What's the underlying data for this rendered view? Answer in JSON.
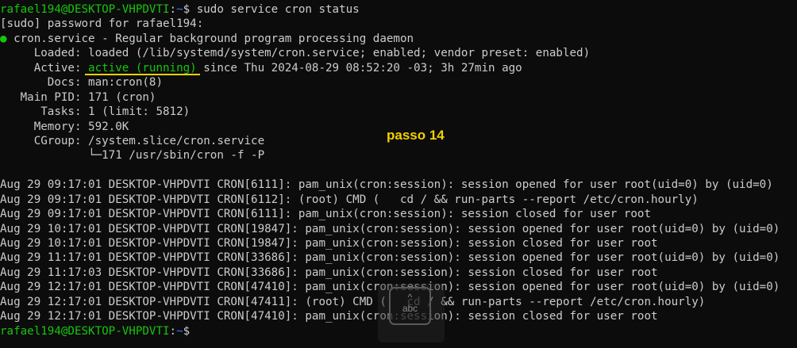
{
  "terminal": {
    "lines": [
      {
        "segments": [
          {
            "t": "rafael194@DESKTOP-VHPDVTI",
            "c": "g"
          },
          {
            "t": ":",
            "c": ""
          },
          {
            "t": "~",
            "c": "b"
          },
          {
            "t": "$ sudo service cron status",
            "c": ""
          }
        ]
      },
      {
        "segments": [
          {
            "t": "[sudo] password for rafael194:",
            "c": ""
          }
        ]
      },
      {
        "segments": [
          {
            "t": "●",
            "c": "g"
          },
          {
            "t": " cron.service - Regular background program processing daemon",
            "c": ""
          }
        ]
      },
      {
        "segments": [
          {
            "t": "     Loaded: loaded (/lib/systemd/system/cron.service; enabled; vendor preset: enabled)",
            "c": ""
          }
        ]
      },
      {
        "segments": [
          {
            "t": "     Active: ",
            "c": ""
          },
          {
            "t": "active (running)",
            "c": "g",
            "hl": true
          },
          {
            "t": " since Thu 2024-08-29 08:52:20 -03; 3h 27min ago",
            "c": ""
          }
        ]
      },
      {
        "segments": [
          {
            "t": "       Docs: man:cron(8)",
            "c": ""
          }
        ]
      },
      {
        "segments": [
          {
            "t": "   Main PID: 171 (cron)",
            "c": ""
          }
        ]
      },
      {
        "segments": [
          {
            "t": "      Tasks: 1 (limit: 5812)",
            "c": ""
          }
        ]
      },
      {
        "segments": [
          {
            "t": "     Memory: 592.0K",
            "c": ""
          }
        ]
      },
      {
        "segments": [
          {
            "t": "     CGroup: /system.slice/cron.service",
            "c": ""
          }
        ]
      },
      {
        "segments": [
          {
            "t": "             └─171 /usr/sbin/cron -f -P",
            "c": ""
          }
        ]
      },
      {
        "segments": [
          {
            "t": "",
            "c": ""
          }
        ]
      },
      {
        "segments": [
          {
            "t": "Aug 29 09:17:01 DESKTOP-VHPDVTI CRON[6111]: pam_unix(cron:session): session opened for user root(uid=0) by (uid=0)",
            "c": ""
          }
        ]
      },
      {
        "segments": [
          {
            "t": "Aug 29 09:17:01 DESKTOP-VHPDVTI CRON[6112]: (root) CMD (   cd / && run-parts --report /etc/cron.hourly)",
            "c": ""
          }
        ]
      },
      {
        "segments": [
          {
            "t": "Aug 29 09:17:01 DESKTOP-VHPDVTI CRON[6111]: pam_unix(cron:session): session closed for user root",
            "c": ""
          }
        ]
      },
      {
        "segments": [
          {
            "t": "Aug 29 10:17:01 DESKTOP-VHPDVTI CRON[19847]: pam_unix(cron:session): session opened for user root(uid=0) by (uid=0)",
            "c": ""
          }
        ]
      },
      {
        "segments": [
          {
            "t": "Aug 29 10:17:01 DESKTOP-VHPDVTI CRON[19847]: pam_unix(cron:session): session closed for user root",
            "c": ""
          }
        ]
      },
      {
        "segments": [
          {
            "t": "Aug 29 11:17:01 DESKTOP-VHPDVTI CRON[33686]: pam_unix(cron:session): session opened for user root(uid=0) by (uid=0)",
            "c": ""
          }
        ]
      },
      {
        "segments": [
          {
            "t": "Aug 29 11:17:03 DESKTOP-VHPDVTI CRON[33686]: pam_unix(cron:session): session closed for user root",
            "c": ""
          }
        ]
      },
      {
        "segments": [
          {
            "t": "Aug 29 12:17:01 DESKTOP-VHPDVTI CRON[47410]: pam_unix(cron:session): session opened for user root(uid=0) by (uid=0)",
            "c": ""
          }
        ]
      },
      {
        "segments": [
          {
            "t": "Aug 29 12:17:01 DESKTOP-VHPDVTI CRON[47411]: (root) CMD (   cd / && run-parts --report /etc/cron.hourly)",
            "c": ""
          }
        ]
      },
      {
        "segments": [
          {
            "t": "Aug 29 12:17:01 DESKTOP-VHPDVTI CRON[47410]: pam_unix(cron:session): session closed for user root",
            "c": ""
          }
        ]
      },
      {
        "segments": [
          {
            "t": "rafael194@DESKTOP-VHPDVTI",
            "c": "g"
          },
          {
            "t": ":",
            "c": ""
          },
          {
            "t": "~",
            "c": "b"
          },
          {
            "t": "$",
            "c": ""
          }
        ]
      }
    ]
  },
  "annotation": {
    "text": "passo 14"
  },
  "ime_indicator": {
    "caret": "^",
    "text": "abc"
  },
  "colors": {
    "background": "#0c0c0c",
    "text": "#cccccc",
    "green": "#16c60c",
    "blue": "#3b78ff",
    "annotation": "#f2d100"
  }
}
